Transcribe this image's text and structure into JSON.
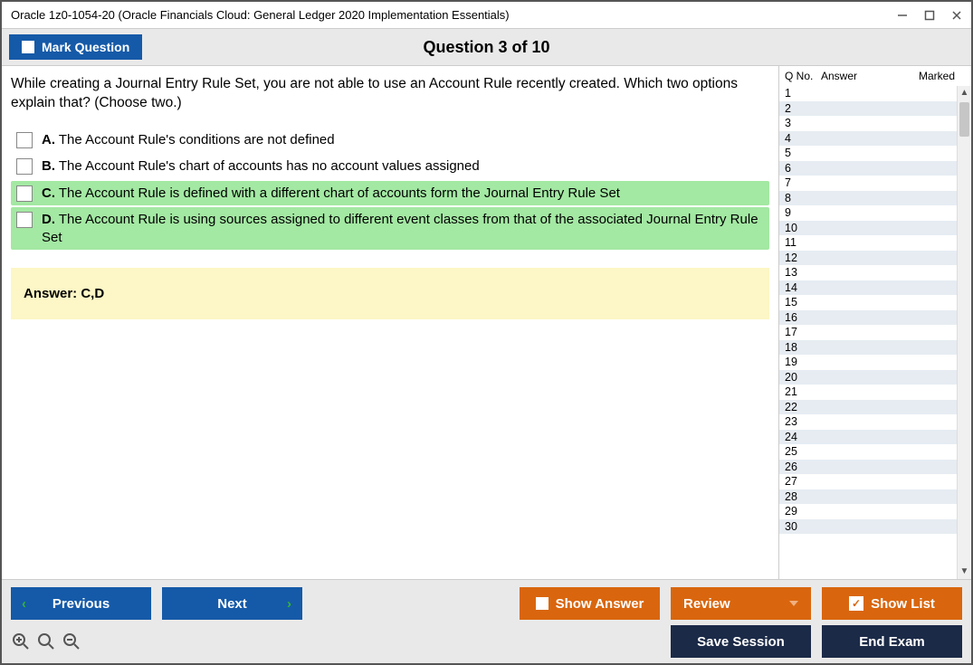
{
  "window": {
    "title": "Oracle 1z0-1054-20 (Oracle Financials Cloud: General Ledger 2020 Implementation Essentials)"
  },
  "header": {
    "mark_label": "Mark Question",
    "question_title": "Question 3 of 10"
  },
  "question": {
    "text": "While creating a Journal Entry Rule Set, you are not able to use an Account Rule recently created. Which two options explain that? (Choose two.)",
    "options": [
      {
        "letter": "A.",
        "text": "The Account Rule's conditions are not defined",
        "correct": false
      },
      {
        "letter": "B.",
        "text": "The Account Rule's chart of accounts has no account values assigned",
        "correct": false
      },
      {
        "letter": "C.",
        "text": "The Account Rule is defined with a different chart of accounts form the Journal Entry Rule Set",
        "correct": true
      },
      {
        "letter": "D.",
        "text": "The Account Rule is using sources assigned to different event classes from that of the associated Journal Entry Rule Set",
        "correct": true
      }
    ],
    "answer_label": "Answer: C,D"
  },
  "sidebar": {
    "headers": {
      "qno": "Q No.",
      "answer": "Answer",
      "marked": "Marked"
    },
    "count": 30
  },
  "footer": {
    "previous": "Previous",
    "next": "Next",
    "show_answer": "Show Answer",
    "review": "Review",
    "show_list": "Show List",
    "save_session": "Save Session",
    "end_exam": "End Exam"
  }
}
